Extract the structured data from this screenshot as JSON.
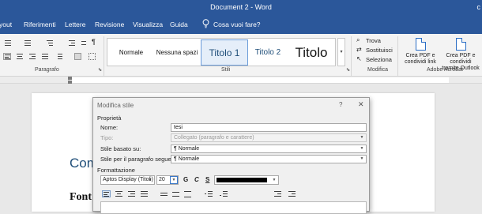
{
  "window": {
    "title": "Document 2  -  Word",
    "corner": "c"
  },
  "tabs": [
    "yout",
    "Riferimenti",
    "Lettere",
    "Revisione",
    "Visualizza",
    "Guida"
  ],
  "tell_me": "Cosa vuoi fare?",
  "ribbon": {
    "groups": {
      "paragraph": "Paragrafo",
      "styles": "Stili",
      "modify": "Modifica",
      "acrobat": "Adobe Acrobat"
    },
    "styles": [
      {
        "label": "Normale"
      },
      {
        "label": "Nessuna spazi"
      },
      {
        "label": "Titolo 1"
      },
      {
        "label": "Titolo 2"
      },
      {
        "label": "Titolo"
      }
    ],
    "modify": {
      "find": "Trova",
      "replace": "Sostituisci",
      "select": "Seleziona"
    },
    "acrobat": {
      "btn1": [
        "Crea PDF e",
        "condividi link"
      ],
      "btn2": [
        "Crea PDF e condividi",
        "tramite Outlook"
      ]
    }
  },
  "document": {
    "heading": "Com",
    "body": "Font c"
  },
  "dialog": {
    "title": "Modifica stile",
    "help": "?",
    "close": "✕",
    "properties": {
      "section": "Proprietà",
      "name_label": "Nome:",
      "name_value": "tesi",
      "type_label": "Tipo:",
      "type_value": "Collegato (paragrafo e carattere)",
      "based_label": "Stile basato su:",
      "based_value": "Normale",
      "next_label": "Stile per il paragrafo seguente:",
      "next_value": "Normale"
    },
    "formatting": {
      "section": "Formattazione",
      "font": "Aptos Display (Titoli)",
      "size": "20",
      "bold": "G",
      "italic": "C",
      "underline": "S",
      "color": "#000000"
    }
  },
  "colors": {
    "brand": "#2b579a",
    "heading": "#1f4e79"
  }
}
